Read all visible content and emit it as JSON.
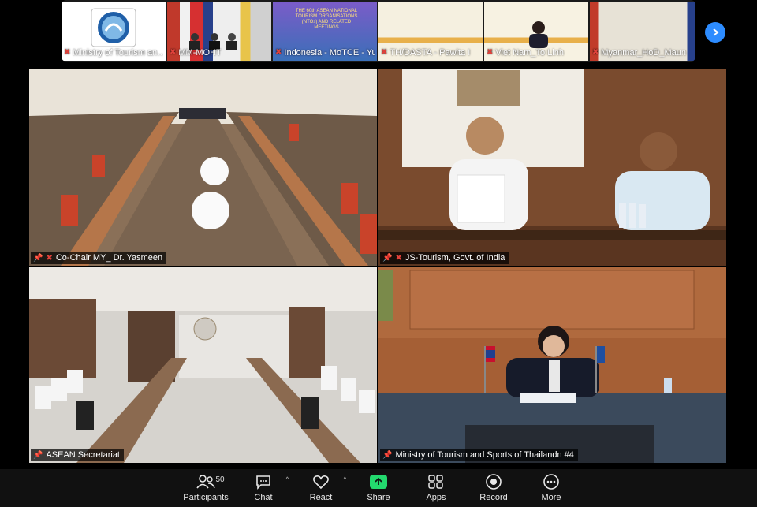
{
  "gallery": {
    "thumbnails": [
      {
        "name": "Ministry of Tourism an…"
      },
      {
        "name": "MM-MOHT"
      },
      {
        "name": "Indonesia - MoTCE - Yulia"
      },
      {
        "name": "TH/DASTA - Pawita I"
      },
      {
        "name": "Viet Nam_To Linh"
      },
      {
        "name": "Myanmar_HoD_Maun"
      }
    ],
    "banner_text": "THE 60th ASEAN NATIONAL TOURISM ORGANISATIONS (NTOs) AND RELATED MEETINGS"
  },
  "tiles": [
    {
      "name": "Co-Chair MY_ Dr. Yasmeen",
      "muted": true
    },
    {
      "name": "JS-Tourism, Govt. of India",
      "muted": true
    },
    {
      "name": "ASEAN Secretariat",
      "muted": false
    },
    {
      "name": "Ministry of Tourism and Sports of Thailandn #4",
      "muted": false
    }
  ],
  "toolbar": {
    "participants_label": "Participants",
    "participants_count": "50",
    "chat_label": "Chat",
    "react_label": "React",
    "share_label": "Share",
    "apps_label": "Apps",
    "record_label": "Record",
    "more_label": "More"
  },
  "colors": {
    "active_speaker": "#23d96e",
    "share": "#23d96e",
    "accent": "#2d8cff",
    "muted_mic": "#e0413a"
  }
}
